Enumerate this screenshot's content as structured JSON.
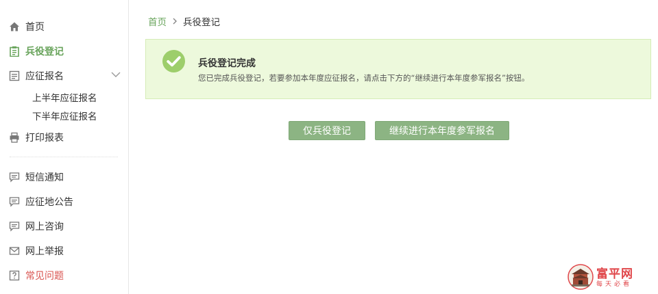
{
  "sidebar": {
    "items": [
      {
        "label": "首页",
        "icon": "home-icon"
      },
      {
        "label": "兵役登记",
        "icon": "clipboard-icon",
        "active": true
      },
      {
        "label": "应征报名",
        "icon": "form-icon",
        "expanded": true,
        "children": [
          {
            "label": "上半年应征报名"
          },
          {
            "label": "下半年应征报名"
          }
        ]
      },
      {
        "label": "打印报表",
        "icon": "printer-icon"
      },
      {
        "label": "短信通知",
        "icon": "message-icon"
      },
      {
        "label": "应征地公告",
        "icon": "message-icon"
      },
      {
        "label": "网上咨询",
        "icon": "message-icon"
      },
      {
        "label": "网上举报",
        "icon": "mail-icon"
      },
      {
        "label": "常见问题",
        "icon": "question-icon"
      }
    ]
  },
  "breadcrumb": {
    "home": "首页",
    "current": "兵役登记"
  },
  "alert": {
    "title": "兵役登记完成",
    "message": "您已完成兵役登记，若要参加本年度应征报名，请点击下方的“继续进行本年度参军报名”按钮。"
  },
  "buttons": {
    "register_only": "仅兵役登记",
    "continue": "继续进行本年度参军报名"
  },
  "watermark": {
    "name": "富平网",
    "slogan": "每天必看"
  },
  "colors": {
    "accent": "#67a35a",
    "button": "#8cb483",
    "alert_bg": "#edf9dc",
    "check": "#9dce6b",
    "faq": "#d9534f",
    "watermark": "#e0464a"
  }
}
